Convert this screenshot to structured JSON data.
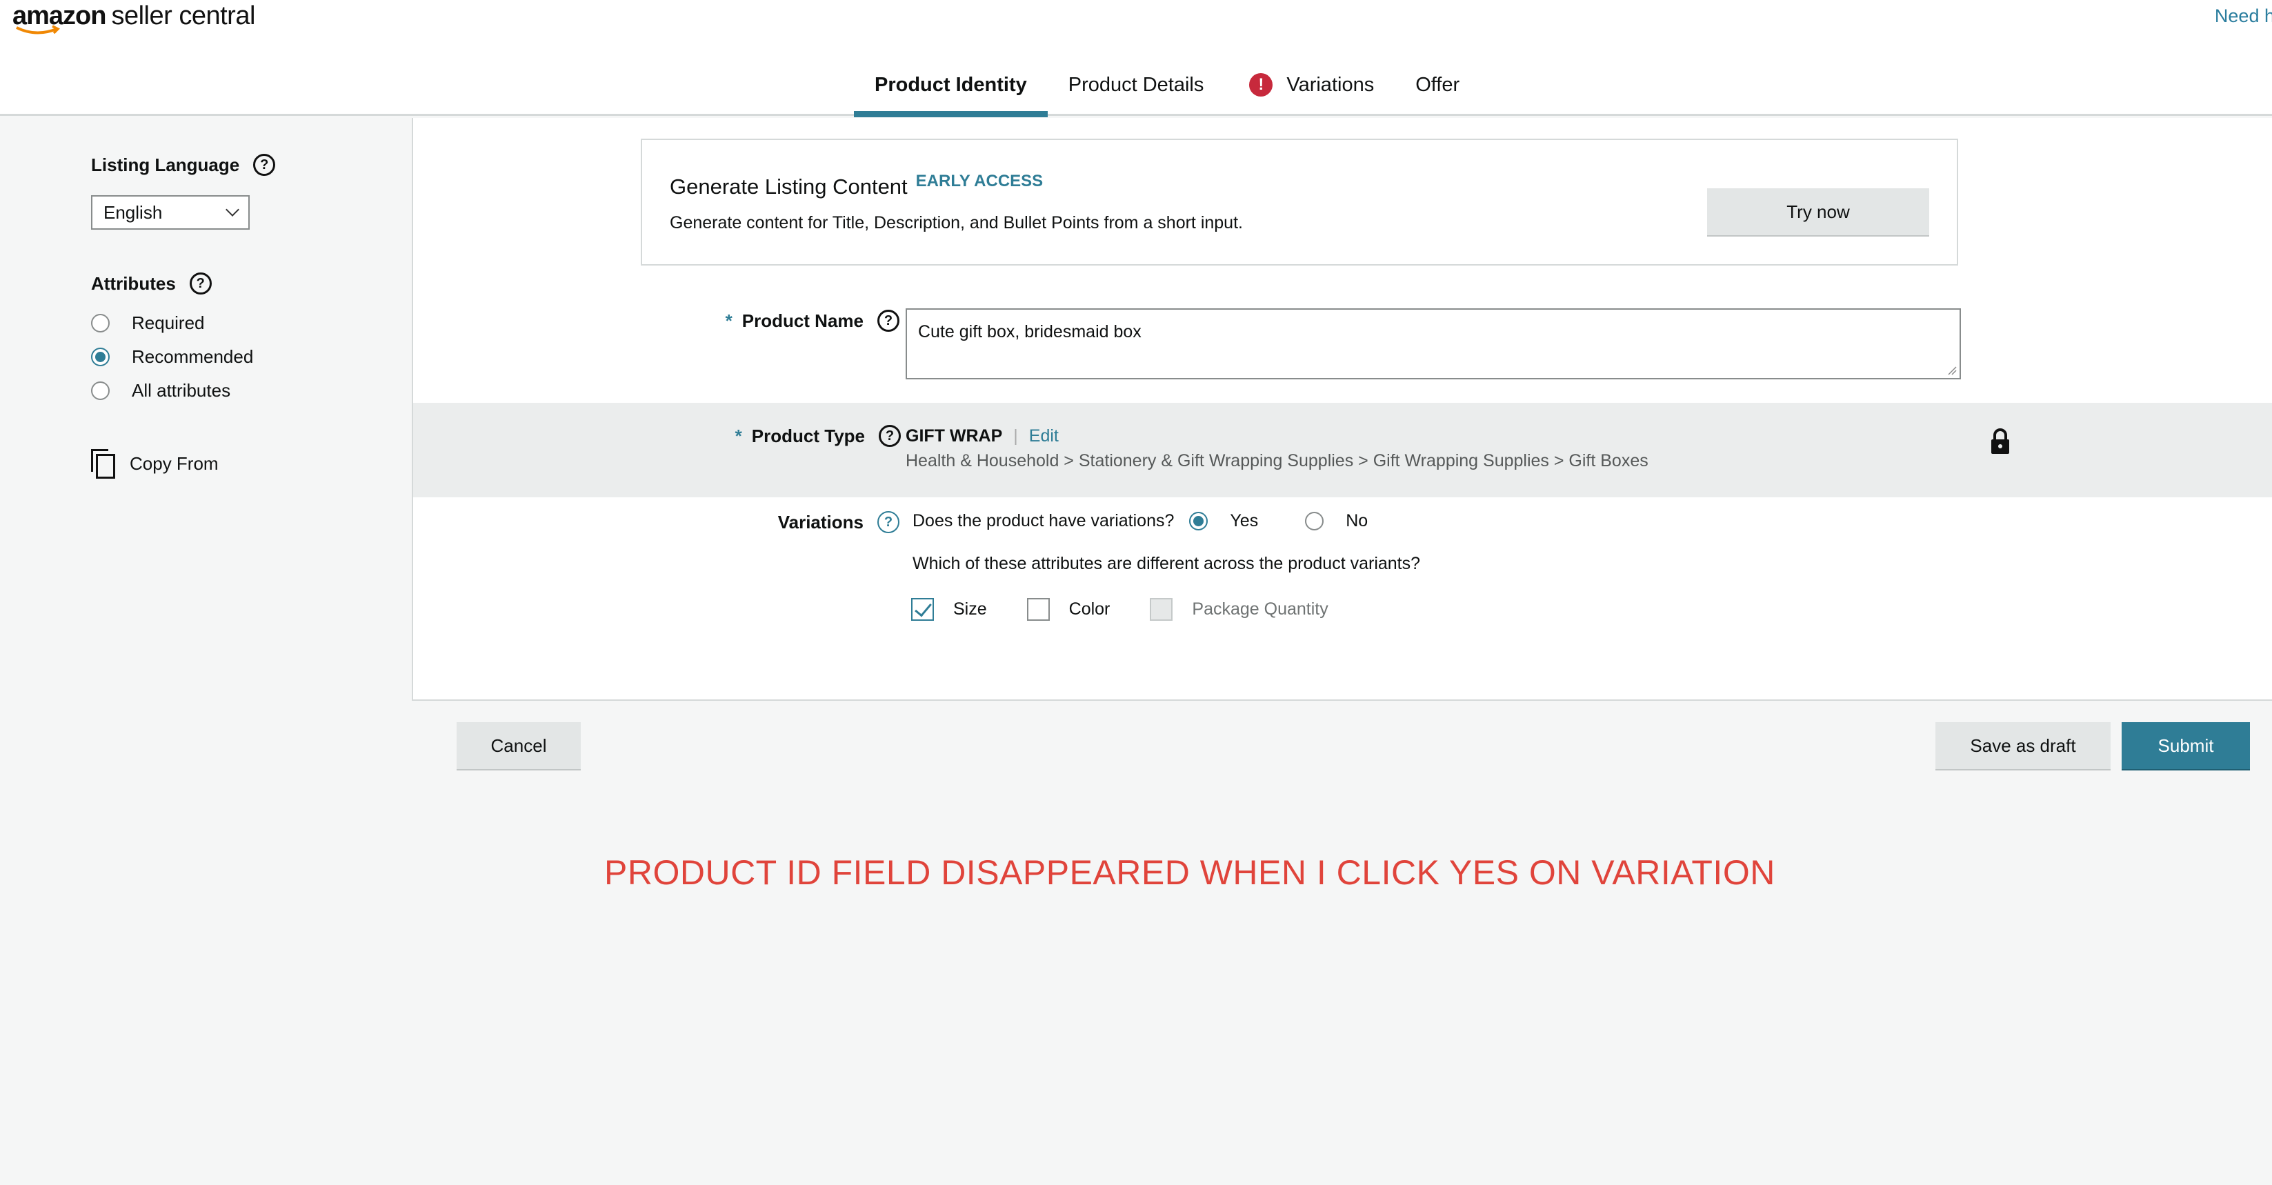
{
  "header": {
    "logo_amazon": "amazon",
    "logo_sc": "seller central",
    "need_help": "Need h",
    "tabs": [
      {
        "label": "Product Identity",
        "active": true
      },
      {
        "label": "Product Details"
      },
      {
        "label": "Variations",
        "error_badge": "!"
      },
      {
        "label": "Offer"
      }
    ]
  },
  "sidebar": {
    "listing_language_label": "Listing Language",
    "help_glyph": "?",
    "language_value": "English",
    "attributes_label": "Attributes",
    "attribute_filters": [
      {
        "label": "Required",
        "selected": false
      },
      {
        "label": "Recommended",
        "selected": true
      },
      {
        "label": "All attributes",
        "selected": false
      }
    ],
    "copy_from": "Copy From"
  },
  "generate": {
    "title": "Generate Listing Content",
    "badge": "EARLY ACCESS",
    "description": "Generate content for Title, Description, and Bullet Points from a short input.",
    "button": "Try now"
  },
  "product_name": {
    "required_mark": "*",
    "label": "Product Name",
    "value": "Cute gift box, bridesmaid box"
  },
  "product_type": {
    "required_mark": "*",
    "label": "Product Type",
    "code": "GIFT WRAP",
    "separator": "|",
    "edit": "Edit",
    "path": "Health & Household > Stationery & Gift Wrapping Supplies > Gift Wrapping Supplies > Gift Boxes"
  },
  "variations": {
    "label": "Variations",
    "question": "Does the product have variations?",
    "yes": "Yes",
    "no": "No",
    "selected": "Yes",
    "attributes_question": "Which of these attributes are different across the product variants?",
    "attributes": [
      {
        "label": "Size",
        "checked": true,
        "disabled": false
      },
      {
        "label": "Color",
        "checked": false,
        "disabled": false
      },
      {
        "label": "Package Quantity",
        "checked": false,
        "disabled": true
      }
    ]
  },
  "actions": {
    "cancel": "Cancel",
    "save_draft": "Save as draft",
    "submit": "Submit"
  },
  "annotation": "PRODUCT ID FIELD DISAPPEARED WHEN I CLICK YES ON VARIATION",
  "colors": {
    "accent": "#2f7d96",
    "error": "#c7293c",
    "annotation": "#e0443b"
  }
}
